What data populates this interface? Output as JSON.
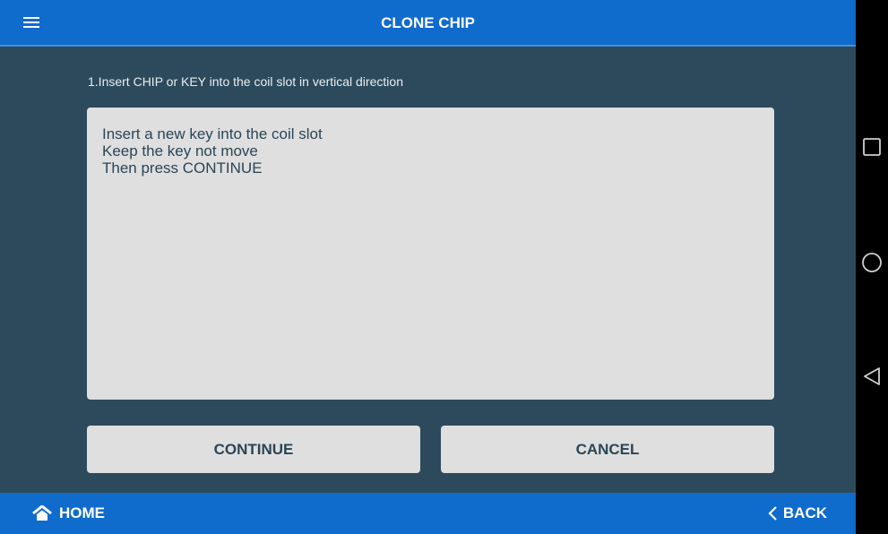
{
  "header": {
    "title": "CLONE CHIP"
  },
  "instruction": "1.Insert CHIP or KEY into the coil slot in vertical direction",
  "message": {
    "lines": [
      "Insert a new key into the coil slot",
      "Keep the key not move",
      "Then press CONTINUE"
    ]
  },
  "buttons": {
    "continue_label": "CONTINUE",
    "cancel_label": "CANCEL"
  },
  "footer": {
    "home_label": "HOME",
    "back_label": "BACK"
  },
  "icons": {
    "menu": "menu-icon",
    "home": "home-icon",
    "back": "chevron-left-icon",
    "android_recents": "square-icon",
    "android_home": "circle-icon",
    "android_back": "triangle-back-icon"
  },
  "colors": {
    "header_bg": "#0f6bcc",
    "body_bg": "#2d4a5c",
    "panel_bg": "#dfdfdf",
    "panel_text": "#2a4556",
    "system_nav_bg": "#000000"
  }
}
